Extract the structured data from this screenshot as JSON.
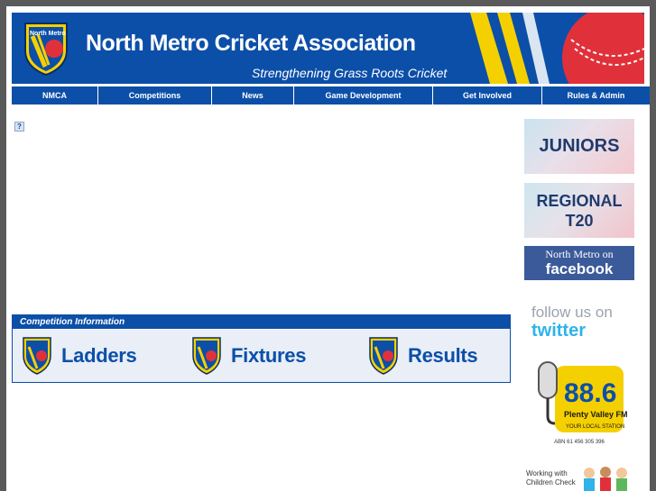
{
  "banner": {
    "title": "North Metro Cricket Association",
    "tagline": "Strengthening Grass Roots Cricket",
    "logo_text": "North Metro"
  },
  "nav": {
    "items": [
      {
        "label": "NMCA"
      },
      {
        "label": "Competitions"
      },
      {
        "label": "News"
      },
      {
        "label": "Game Development"
      },
      {
        "label": "Get Involved"
      },
      {
        "label": "Rules & Admin"
      }
    ]
  },
  "main": {
    "broken_image_glyph": "?"
  },
  "competition": {
    "heading": "Competition Information",
    "links": [
      {
        "label": "Ladders"
      },
      {
        "label": "Fixtures"
      },
      {
        "label": "Results"
      }
    ]
  },
  "sidebar": {
    "juniors": "JUNIORS",
    "regional_line1": "REGIONAL",
    "regional_line2": "T20",
    "facebook_line1": "North Metro on",
    "facebook_line2": "facebook",
    "twitter_line1": "follow us on",
    "twitter_line2": "twitter",
    "radio_freq": "88.6",
    "radio_name": "Plenty Valley FM",
    "radio_tag": "YOUR LOCAL STATION",
    "radio_abn": "ABN 61 456 305 396",
    "wwc_line1": "Working with",
    "wwc_line2": "Children Check"
  },
  "colors": {
    "brand_blue": "#0c4fa8",
    "accent_yellow": "#f5d000",
    "accent_red": "#e0313b",
    "facebook_blue": "#3b5a9a",
    "twitter_blue": "#2fb3e8"
  }
}
